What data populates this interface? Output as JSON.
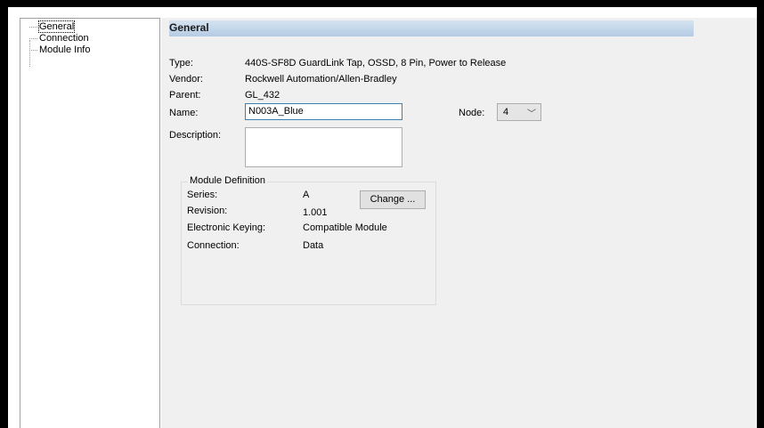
{
  "tree": {
    "items": [
      "General",
      "Connection",
      "Module Info"
    ]
  },
  "header": {
    "title": "General"
  },
  "fields": {
    "type_label": "Type:",
    "type_value": "440S-SF8D GuardLink Tap, OSSD, 8 Pin, Power to Release",
    "vendor_label": "Vendor:",
    "vendor_value": "Rockwell Automation/Allen-Bradley",
    "parent_label": "Parent:",
    "parent_value": "GL_432",
    "name_label": "Name:",
    "name_value": "N003A_Blue",
    "node_label": "Node:",
    "node_value": "4",
    "description_label": "Description:",
    "description_value": ""
  },
  "module_definition": {
    "title": "Module Definition",
    "series_label": "Series:",
    "series_value": "A",
    "revision_label": "Revision:",
    "revision_value": "1.001",
    "keying_label": "Electronic Keying:",
    "keying_value": "Compatible Module",
    "connection_label": "Connection:",
    "connection_value": "Data",
    "change_button": "Change ..."
  }
}
